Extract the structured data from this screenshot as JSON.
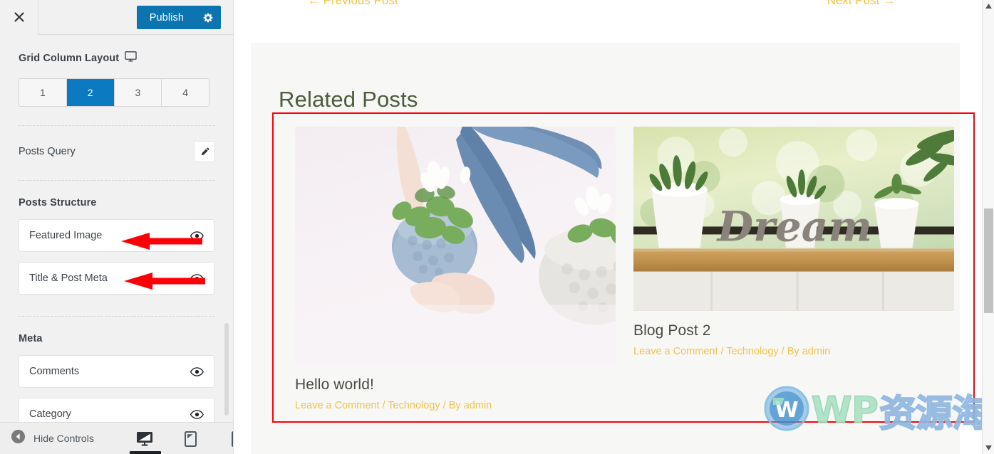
{
  "sidebar": {
    "header": {
      "close_icon": "close-icon",
      "publish_label": "Publish",
      "gear_icon": "gear-icon"
    },
    "grid_column_layout": {
      "title": "Grid Column Layout",
      "responsive_icon": "monitor-icon",
      "options": [
        "1",
        "2",
        "3",
        "4"
      ],
      "selected": "2",
      "active_color": "#0b7ac0"
    },
    "posts_query": {
      "label": "Posts Query",
      "edit_icon": "pencil-icon"
    },
    "posts_structure": {
      "title": "Posts Structure",
      "items": [
        {
          "label": "Featured Image",
          "visibility_icon": "eye-icon",
          "annotated": true
        },
        {
          "label": "Title & Post Meta",
          "visibility_icon": "eye-icon",
          "annotated": true
        }
      ]
    },
    "meta": {
      "title": "Meta",
      "items": [
        {
          "label": "Comments",
          "visibility_icon": "eye-icon"
        },
        {
          "label": "Category",
          "visibility_icon": "eye-icon"
        }
      ]
    },
    "footer": {
      "hide_controls_label": "Hide Controls",
      "collapse_icon": "collapse-left-icon",
      "devices": [
        {
          "name": "desktop-preview",
          "icon": "desktop-icon",
          "active": true
        },
        {
          "name": "tablet-preview",
          "icon": "tablet-icon",
          "active": false
        },
        {
          "name": "mobile-preview",
          "icon": "mobile-icon",
          "active": false
        }
      ]
    }
  },
  "preview": {
    "post_nav": {
      "previous": "← Previous Post",
      "next": "Next Post →",
      "link_color": "#f6c344"
    },
    "related": {
      "heading": "Related Posts",
      "highlight_color": "#fb0007",
      "posts": [
        {
          "title": "Hello world!",
          "comments": "Leave a Comment",
          "category": "Technology",
          "author": "By admin",
          "meta_line": "Leave a Comment / Technology / By admin",
          "image_alt": "hands-planting-in-crochet-basket"
        },
        {
          "title": "Blog Post 2",
          "comments": "Leave a Comment",
          "category": "Technology",
          "author": "By admin",
          "meta_line": "Leave a Comment / Technology / By admin",
          "image_alt": "potted-plants-with-dream-sign-on-windowsill"
        }
      ]
    },
    "watermark": {
      "logo_icon": "wordpress-logo-icon",
      "text_en": "WP",
      "text_cn": "资源海"
    }
  },
  "scrollbars": {
    "page_vertical": {
      "up_icon": "caret-up-icon",
      "down_icon": "caret-down-icon"
    }
  }
}
